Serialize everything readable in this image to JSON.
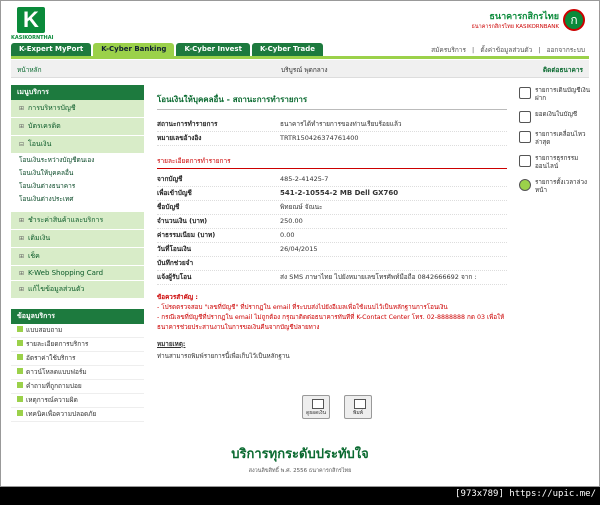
{
  "logo": {
    "letter": "K",
    "text": "KASIKORNTHAI"
  },
  "bank": {
    "name_th": "ธนาคารกสิกรไทย",
    "name_en": "ธนาคารกสิกรไทย KASIKORNBANK",
    "seal": "ก"
  },
  "tabs": [
    "K-Expert MyPort",
    "K-Cyber Banking",
    "K-Cyber Invest",
    "K-Cyber Trade"
  ],
  "toplinks": [
    "สมัครบริการ",
    "|",
    "ตั้งค่าข้อมูลส่วนตัว",
    "|",
    "ออกจากระบบ"
  ],
  "crumb": {
    "home": "หน้าหลัก",
    "user": "บริบูรณ์ พุดกลาง",
    "contact": "ติดต่อธนาคาร"
  },
  "menu": {
    "header": "เมนูบริการ",
    "groups": [
      {
        "label": "การบริหารบัญชี"
      },
      {
        "label": "บัตรเครดิต"
      },
      {
        "label": "โอนเงิน",
        "subs": [
          "โอนเงินระหว่างบัญชีตนเอง",
          "โอนเงินให้บุคคลอื่น",
          "โอนเงินต่างธนาคาร",
          "โอนเงินต่างประเทศ"
        ]
      },
      {
        "label": "ชำระค่าสินค้าและบริการ"
      },
      {
        "label": "เติมเงิน"
      },
      {
        "label": "เช็ค"
      },
      {
        "label": "K-Web Shopping Card"
      },
      {
        "label": "แก้ไขข้อมูลส่วนตัว"
      }
    ],
    "header2": "ข้อมูลบริการ",
    "info": [
      "แบบสอบถาม",
      "รายละเอียดการบริการ",
      "อัตราค่าใช้บริการ",
      "ดาวน์โหลดแบบฟอร์ม",
      "คำถามที่ถูกถามบ่อย",
      "เหตุการณ์ความผิด",
      "เทคนิคเพื่อความปลอดภัย"
    ]
  },
  "main": {
    "title": "โอนเงินให้บุคคลอื่น - สถานะการทำรายการ",
    "status_label": "สถานะการทำรายการ",
    "status_value": "ธนาคารได้ทำรายการของท่านเรียบร้อยแล้ว",
    "ref_label": "หมายเลขอ้างอิง",
    "ref_value": "TRTR150426374761400",
    "section": "รายละเอียดการทำรายการ",
    "rows": [
      {
        "label": "จากบัญชี",
        "value": "485-2-41425-7",
        "big": false
      },
      {
        "label": "เพื่อเข้าบัญชี",
        "value": "541-2-10554-2 MB Dell GX760",
        "big": true
      },
      {
        "label": "ชื่อบัญชี",
        "value": "พิทยณษ์ จัณนะ",
        "big": false
      },
      {
        "label": "จำนวนเงิน (บาท)",
        "value": "250.00",
        "big": false
      },
      {
        "label": "ค่าธรรมเนียม (บาท)",
        "value": "0.00",
        "big": false
      },
      {
        "label": "วันที่โอนเงิน",
        "value": "26/04/2015",
        "big": false
      },
      {
        "label": "บันทึกช่วยจำ",
        "value": "",
        "big": false
      },
      {
        "label": "แจ้งผู้รับโอน",
        "value": "ส่ง SMS ภาษาไทย ไปยังหมายเลขโทรศัพท์มือถือ 0842666692 จาก :",
        "big": false
      }
    ],
    "warn_head": "ข้อควรสำคัญ :",
    "warn1": "- โปรดตรวจสอบ \"เลขที่บัญชี\" ที่ปรากฏใน email ที่ระบบส่งไปยังอีเมลเพื่อใช้แนบไว้เป็นหลักฐานการโอนเงิน",
    "warn2": "- กรณีเลขที่บัญชีที่ปรากฏใน email ไม่ถูกต้อง กรุณาติดต่อธนาคารทันทีที่ K-Contact Center โทร. 02-8888888 กด 03 เพื่อให้ธนาคารช่วยประสานงานในการขอเงินคืนจากบัญชีปลายทาง",
    "note_head": "หมายเหตุ:",
    "note": "ท่านสามารถพิมพ์รายการนี้เพื่อเก็บไว้เป็นหลักฐาน",
    "btn_save": "ดูยอดเงิน",
    "btn_print": "พิมพ์"
  },
  "right": [
    "รายการเดินบัญชีเงินฝาก",
    "ยอดเงินในบัญชี",
    "รายการเคลื่อนไหวล่าสุด",
    "รายการธุรกรรมออนไลน์",
    "รายการตั้งเวลาล่วงหน้า"
  ],
  "slogan": "บริการทุกระดับประทับใจ",
  "copyright": "สงวนลิขสิทธิ์ พ.ศ. 2556 ธนาคารกสิกรไทย",
  "watermark": "[973x789] https://upic.me/"
}
